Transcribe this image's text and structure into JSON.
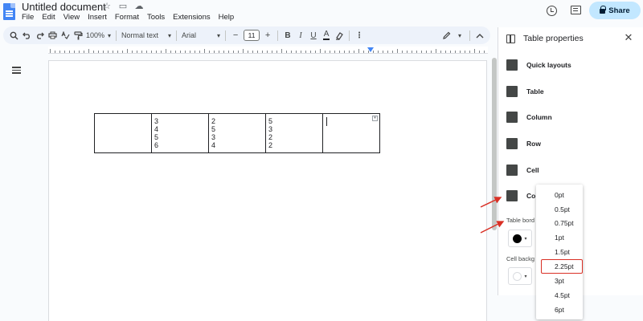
{
  "header": {
    "doc_title": "Untitled document",
    "menu": [
      "File",
      "Edit",
      "View",
      "Insert",
      "Format",
      "Tools",
      "Extensions",
      "Help"
    ],
    "share_label": "Share"
  },
  "toolbar": {
    "zoom": "100%",
    "style": "Normal text",
    "font": "Arial",
    "font_size": "11",
    "minus": "−",
    "plus": "+",
    "bold": "B",
    "italic": "I",
    "underline": "U",
    "text_color": "A"
  },
  "table": {
    "rows": [
      [
        [],
        [
          "3",
          "4",
          "5",
          "6"
        ],
        [
          "2",
          "5",
          "3",
          "4"
        ],
        [
          "5",
          "3",
          "2",
          "2"
        ],
        []
      ]
    ]
  },
  "panel": {
    "title": "Table properties",
    "sections": [
      "Quick layouts",
      "Table",
      "Column",
      "Row",
      "Cell",
      "Colo"
    ],
    "table_border_label": "Table bord",
    "cell_background_label": "Cell backg",
    "border_color": "#000000",
    "background_color": "#ffffff"
  },
  "border_width_menu": {
    "options": [
      "0pt",
      "0.5pt",
      "0.75pt",
      "1pt",
      "1.5pt",
      "2.25pt",
      "3pt",
      "4.5pt",
      "6pt"
    ],
    "selected": "2.25pt"
  },
  "colors": {
    "accent": "#4285f4",
    "share_bg": "#c2e7ff",
    "highlight": "#d93025"
  }
}
